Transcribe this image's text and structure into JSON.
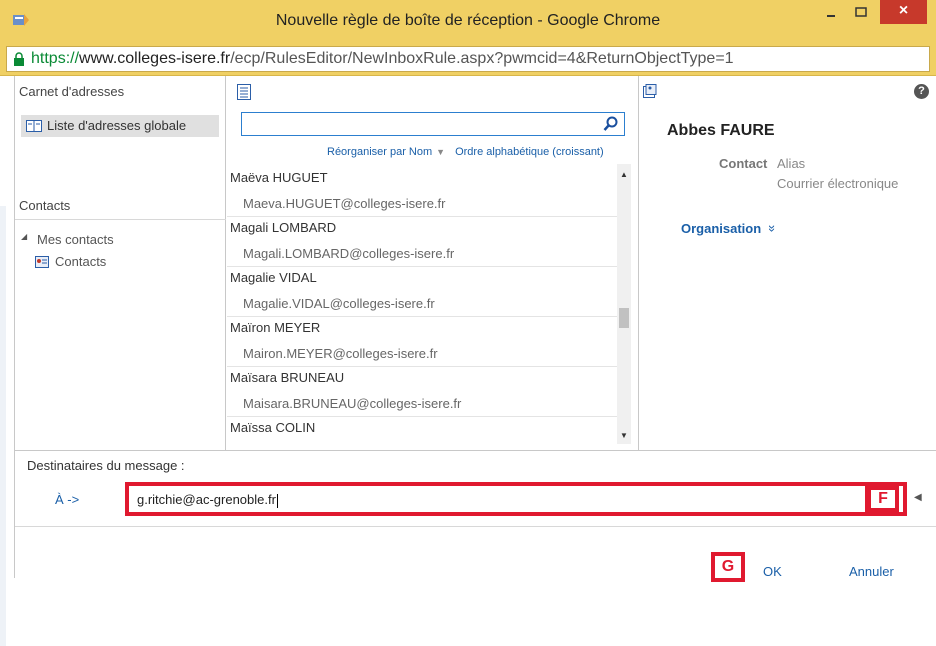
{
  "window": {
    "title": "Nouvelle règle de boîte de réception - Google Chrome",
    "close_glyph": "×",
    "url_scheme": "https://",
    "url_host": "www.colleges-isere.fr",
    "url_path": "/ecp/RulesEditor/NewInboxRule.aspx?pwmcid=4&ReturnObjectType=1"
  },
  "left_pane": {
    "address_book_title": "Carnet d'adresses",
    "global_list_label": "Liste d'adresses globale",
    "contacts_title": "Contacts",
    "my_contacts_label": "Mes contacts",
    "contacts_folder_label": "Contacts",
    "tree_toggle": "◢"
  },
  "middle_pane": {
    "search_placeholder": "",
    "sort_by": "Réorganiser par Nom",
    "sort_arrow": "▼",
    "sort_order": "Ordre alphabétique (croissant)",
    "scroll_up": "▲",
    "scroll_down": "▼",
    "contacts": [
      {
        "name": "Maëva HUGUET",
        "email": "Maeva.HUGUET@colleges-isere.fr"
      },
      {
        "name": "Magali LOMBARD",
        "email": "Magali.LOMBARD@colleges-isere.fr"
      },
      {
        "name": "Magalie VIDAL",
        "email": "Magalie.VIDAL@colleges-isere.fr"
      },
      {
        "name": "Maïron MEYER",
        "email": "Mairon.MEYER@colleges-isere.fr"
      },
      {
        "name": "Maïsara BRUNEAU",
        "email": "Maisara.BRUNEAU@colleges-isere.fr"
      },
      {
        "name": "Maïssa COLIN",
        "email": ""
      }
    ]
  },
  "right_pane": {
    "help": "?",
    "person_name": "Abbes FAURE",
    "contact_label": "Contact",
    "alias_label": "Alias",
    "email_label": "Courrier électronique",
    "organisation_label": "Organisation",
    "organisation_chevron": "»"
  },
  "recipients": {
    "section_label": "Destinataires du message :",
    "to_label": "À ->",
    "value": "g.ritchie@ac-grenoble.fr",
    "expand_glyph": "◀"
  },
  "annotations": {
    "badge_f": "F",
    "badge_g": "G"
  },
  "actions": {
    "ok_label": "OK",
    "cancel_label": "Annuler"
  },
  "colors": {
    "title_bar": "#f0d064",
    "accent_link": "#1a5fa8",
    "annotation_red": "#e0192f",
    "close_button": "#c7392b"
  }
}
